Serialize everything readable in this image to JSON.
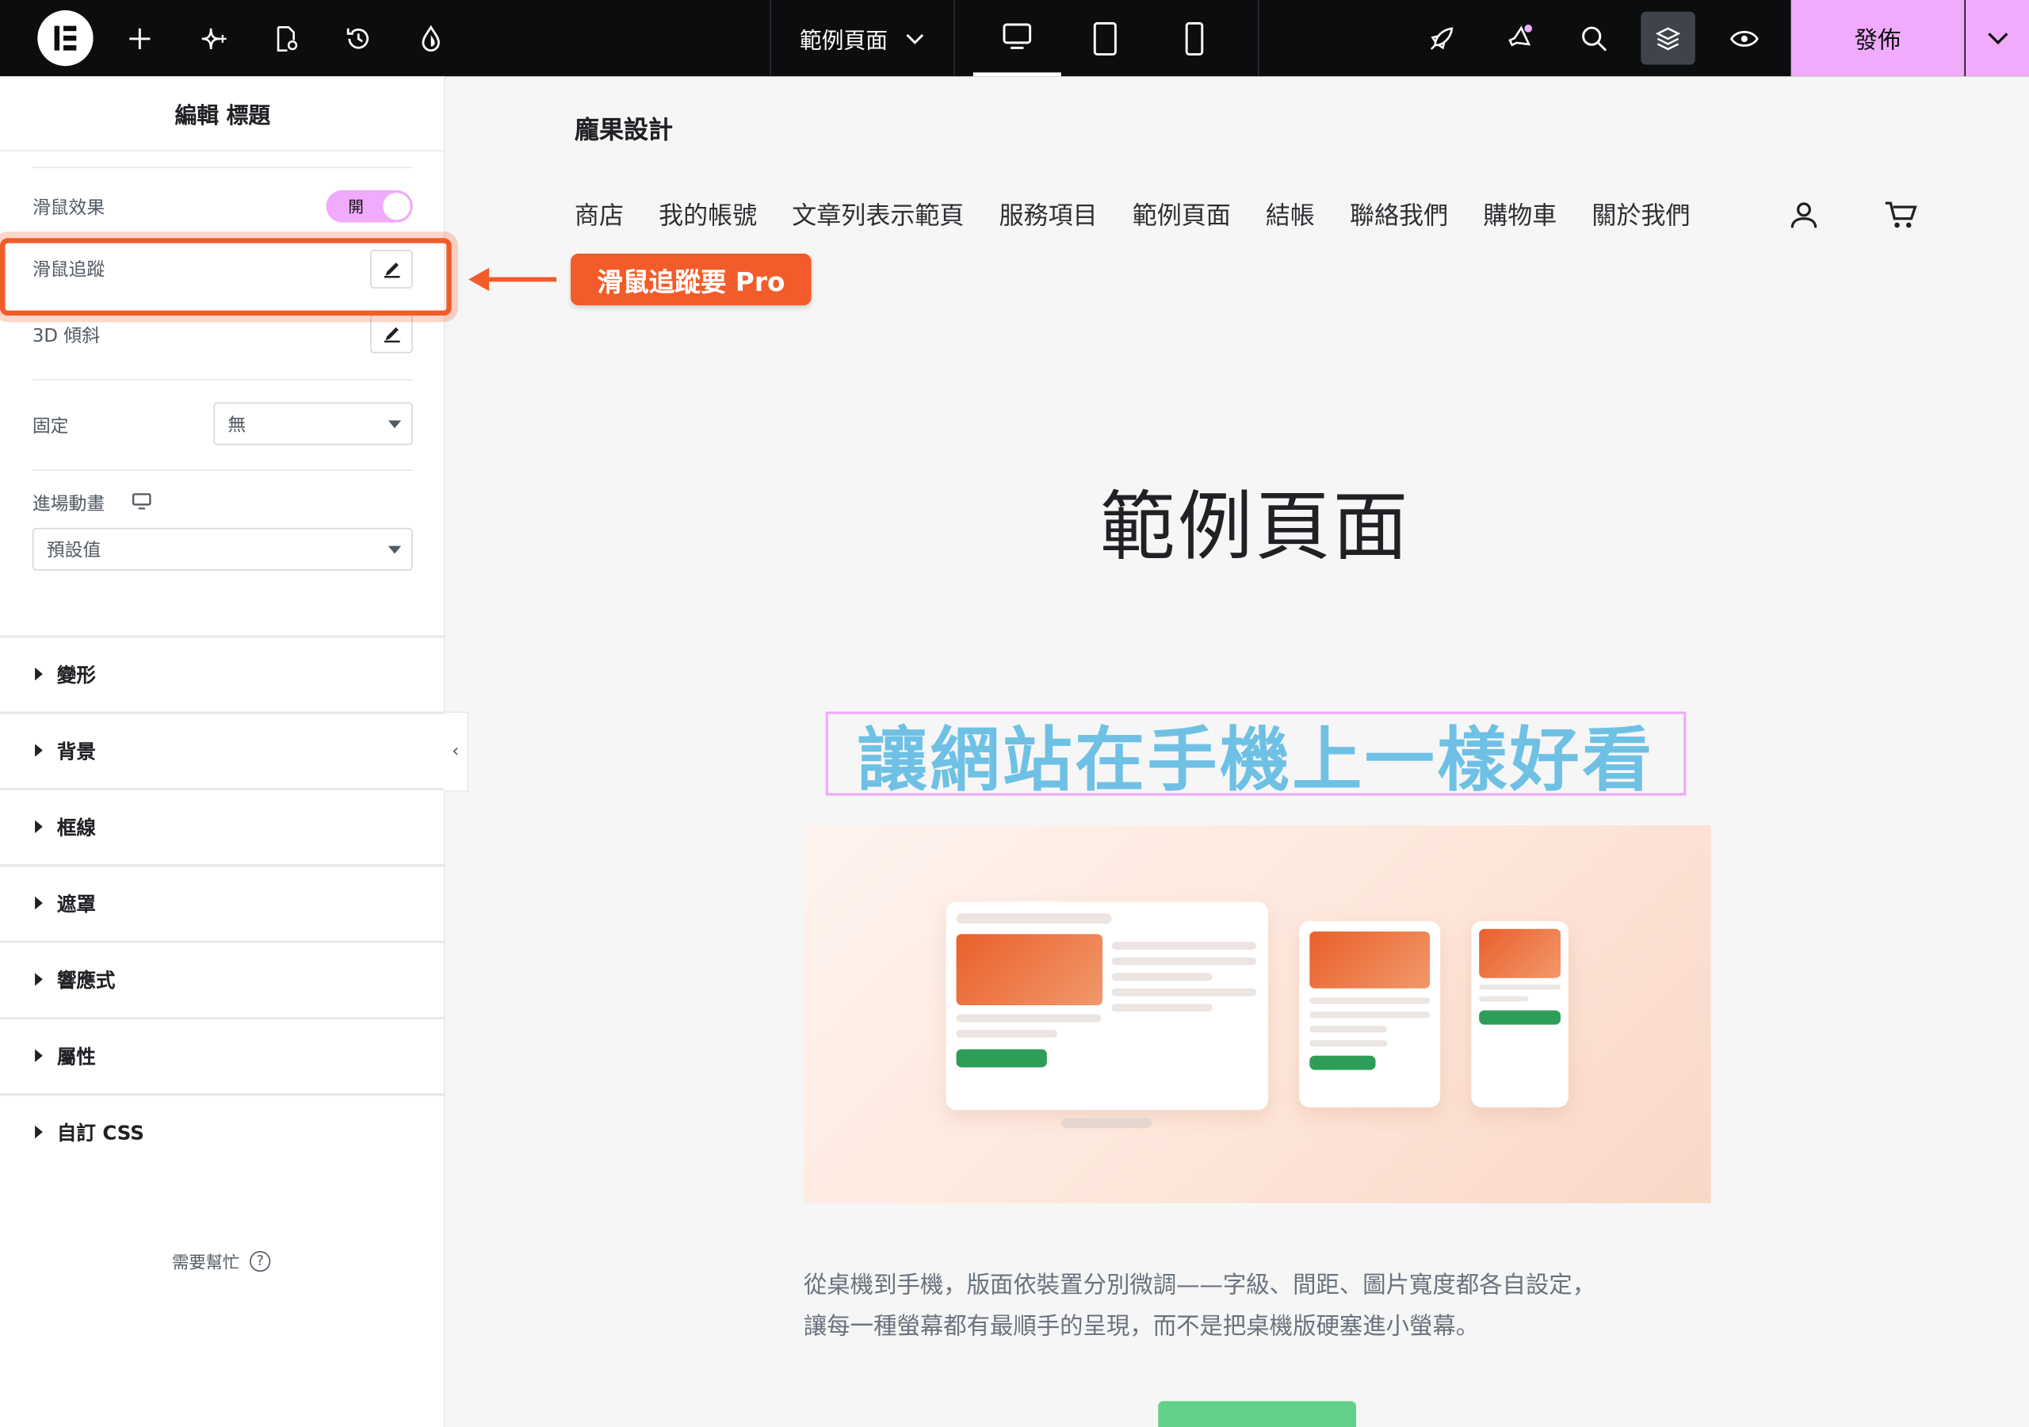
{
  "topbar": {
    "page_name": "範例頁面",
    "publish_label": "發佈",
    "icons": [
      "elementor-logo-icon",
      "add-icon",
      "ai-sparkle-icon",
      "page-settings-icon",
      "history-icon",
      "color-drop-icon",
      "rocket-icon",
      "announcement-icon",
      "search-icon",
      "structure-layers-icon",
      "preview-eye-icon"
    ],
    "devices": [
      "desktop",
      "tablet",
      "mobile"
    ],
    "active_device": "desktop",
    "accent_color": "#f0abfc"
  },
  "panel": {
    "title": "編輯 標題",
    "mouse_effects_label": "滑鼠效果",
    "mouse_effects_toggle": "開",
    "mouse_track_label": "滑鼠追蹤",
    "tilt_label": "3D 傾斜",
    "sticky_label": "固定",
    "sticky_value": "無",
    "entrance_label": "進場動畫",
    "entrance_value": "預設值",
    "sections": [
      "變形",
      "背景",
      "框線",
      "遮罩",
      "響應式",
      "屬性",
      "自訂 CSS"
    ],
    "help_label": "需要幫忙"
  },
  "annotation": {
    "badge_text": "滑鼠追蹤要 Pro",
    "color": "#f25c2a"
  },
  "canvas": {
    "site_title": "龐果設計",
    "nav": [
      "商店",
      "我的帳號",
      "文章列表示範頁",
      "服務項目",
      "範例頁面",
      "結帳",
      "聯絡我們",
      "購物車",
      "關於我們"
    ],
    "page_title": "範例頁面",
    "headline": "讓網站在手機上一樣好看",
    "headline_color": "#6ec1e4",
    "body_line1": "從桌機到手機，版面依裝置分別微調——字級、間距、圖片寬度都各自設定，",
    "body_line2": "讓每一種螢幕都有最順手的呈現，而不是把桌機版硬塞進小螢幕。"
  }
}
